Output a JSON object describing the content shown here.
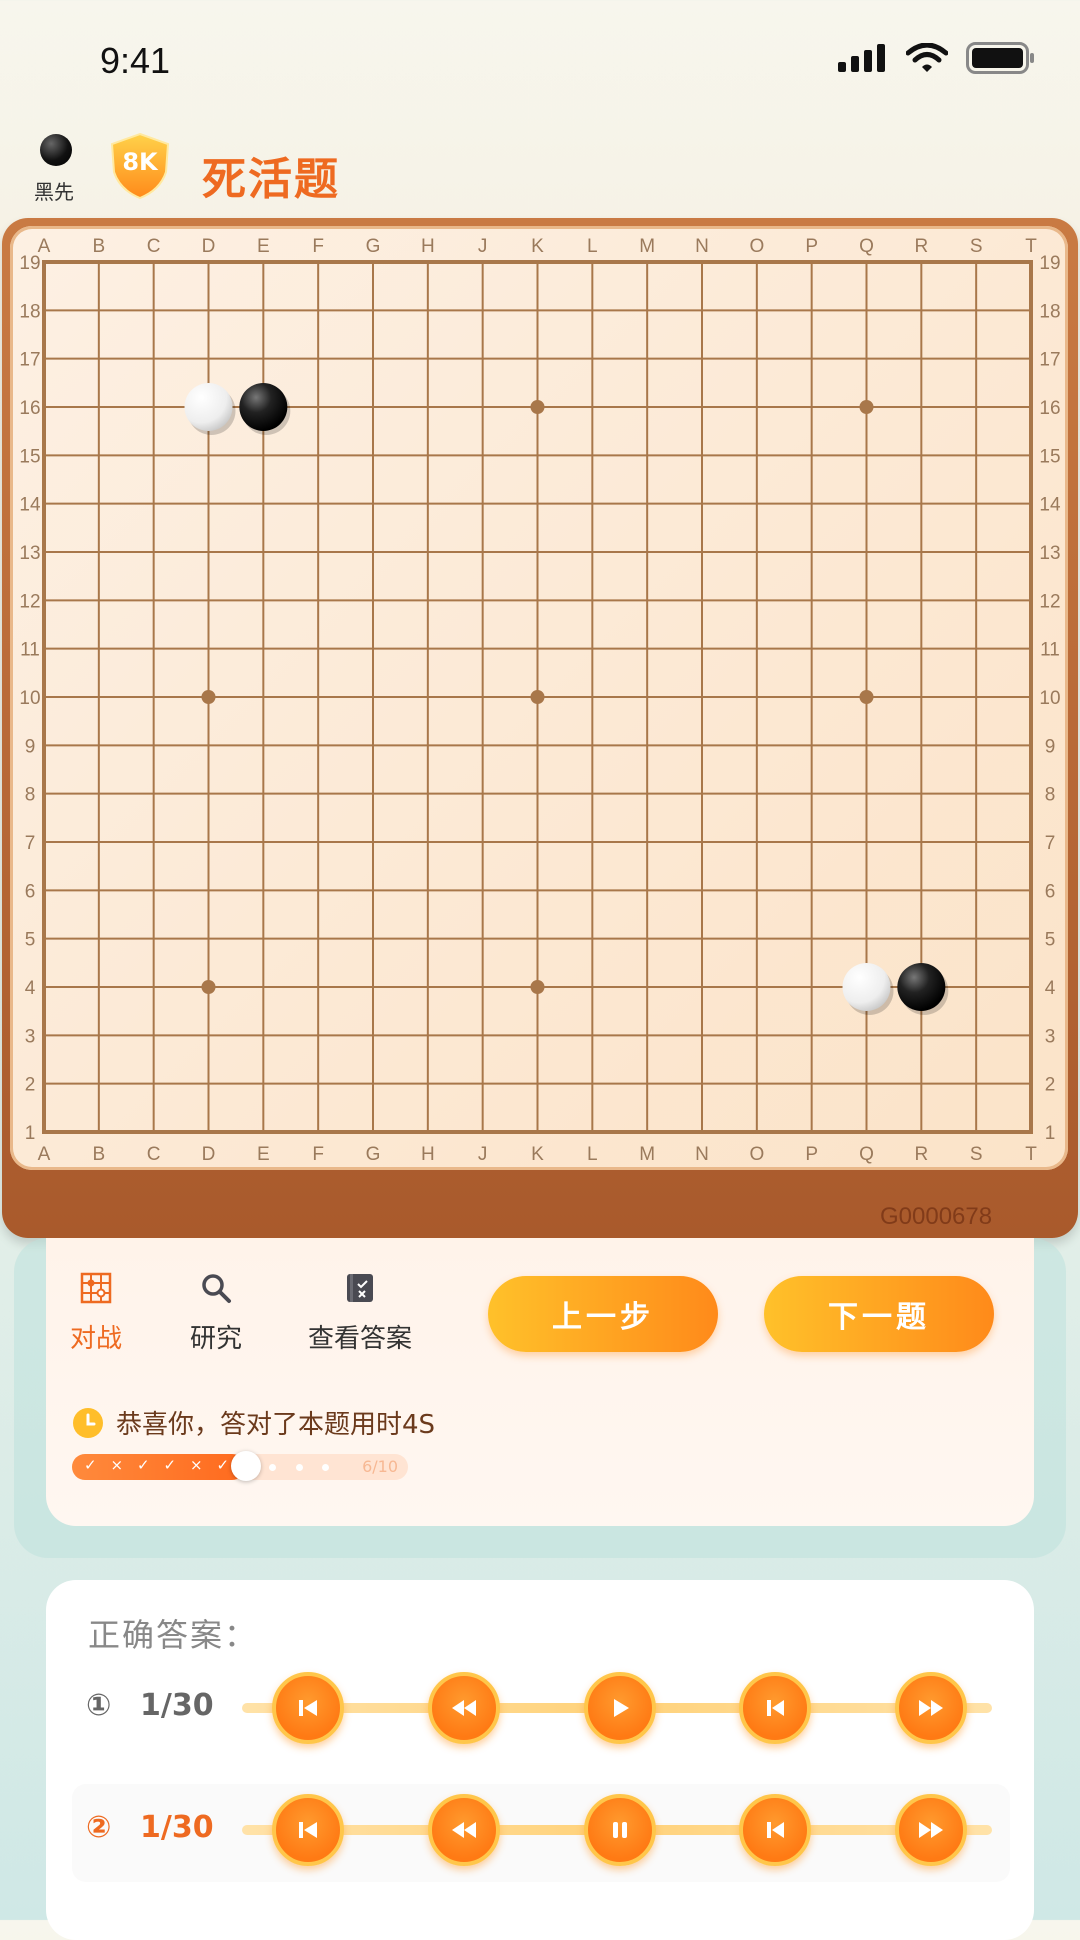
{
  "status_bar": {
    "time": "9:41"
  },
  "header": {
    "first_player": "黑先",
    "rank": "8K",
    "title": "死活题"
  },
  "board": {
    "columns": [
      "A",
      "B",
      "C",
      "D",
      "E",
      "F",
      "G",
      "H",
      "J",
      "K",
      "L",
      "M",
      "N",
      "O",
      "P",
      "Q",
      "R",
      "S",
      "T"
    ],
    "rows": [
      "19",
      "18",
      "17",
      "16",
      "15",
      "14",
      "13",
      "12",
      "11",
      "10",
      "9",
      "8",
      "7",
      "6",
      "5",
      "4",
      "3",
      "2",
      "1"
    ],
    "star_points": [
      {
        "col": "D",
        "row": 16
      },
      {
        "col": "K",
        "row": 16
      },
      {
        "col": "Q",
        "row": 16
      },
      {
        "col": "D",
        "row": 10
      },
      {
        "col": "K",
        "row": 10
      },
      {
        "col": "Q",
        "row": 10
      },
      {
        "col": "D",
        "row": 4
      },
      {
        "col": "K",
        "row": 4
      },
      {
        "col": "Q",
        "row": 4
      }
    ],
    "stones": [
      {
        "col": "D",
        "row": 16,
        "color": "white"
      },
      {
        "col": "E",
        "row": 16,
        "color": "black"
      },
      {
        "col": "Q",
        "row": 4,
        "color": "white"
      },
      {
        "col": "R",
        "row": 4,
        "color": "black"
      }
    ],
    "id": "G0000678"
  },
  "controls": {
    "tools": [
      {
        "label": "对战",
        "icon": "board-icon",
        "active": true
      },
      {
        "label": "研究",
        "icon": "search-icon",
        "active": false
      },
      {
        "label": "查看答案",
        "icon": "answer-icon",
        "active": false
      }
    ],
    "prev_step": "上一步",
    "next_problem": "下一题",
    "result_text": "恭喜你，答对了本题用时4S",
    "progress": {
      "marks": [
        "✓",
        "×",
        "✓",
        "✓",
        "×",
        "✓"
      ],
      "current": 6,
      "total": 10,
      "label": "6/10"
    }
  },
  "answers": {
    "title": "正确答案：",
    "rows": [
      {
        "index": "①",
        "count": "1/30",
        "active": false,
        "buttons": [
          "skip-start-icon",
          "rewind-icon",
          "play-icon",
          "step-back-icon",
          "fast-forward-icon"
        ]
      },
      {
        "index": "②",
        "count": "1/30",
        "active": true,
        "buttons": [
          "skip-start-icon",
          "rewind-icon",
          "pause-icon",
          "step-back-icon",
          "fast-forward-icon"
        ]
      }
    ]
  },
  "colors": {
    "accent": "#ee6a21",
    "board_line": "#a8774a",
    "button_orange": "#ff8a1a"
  }
}
